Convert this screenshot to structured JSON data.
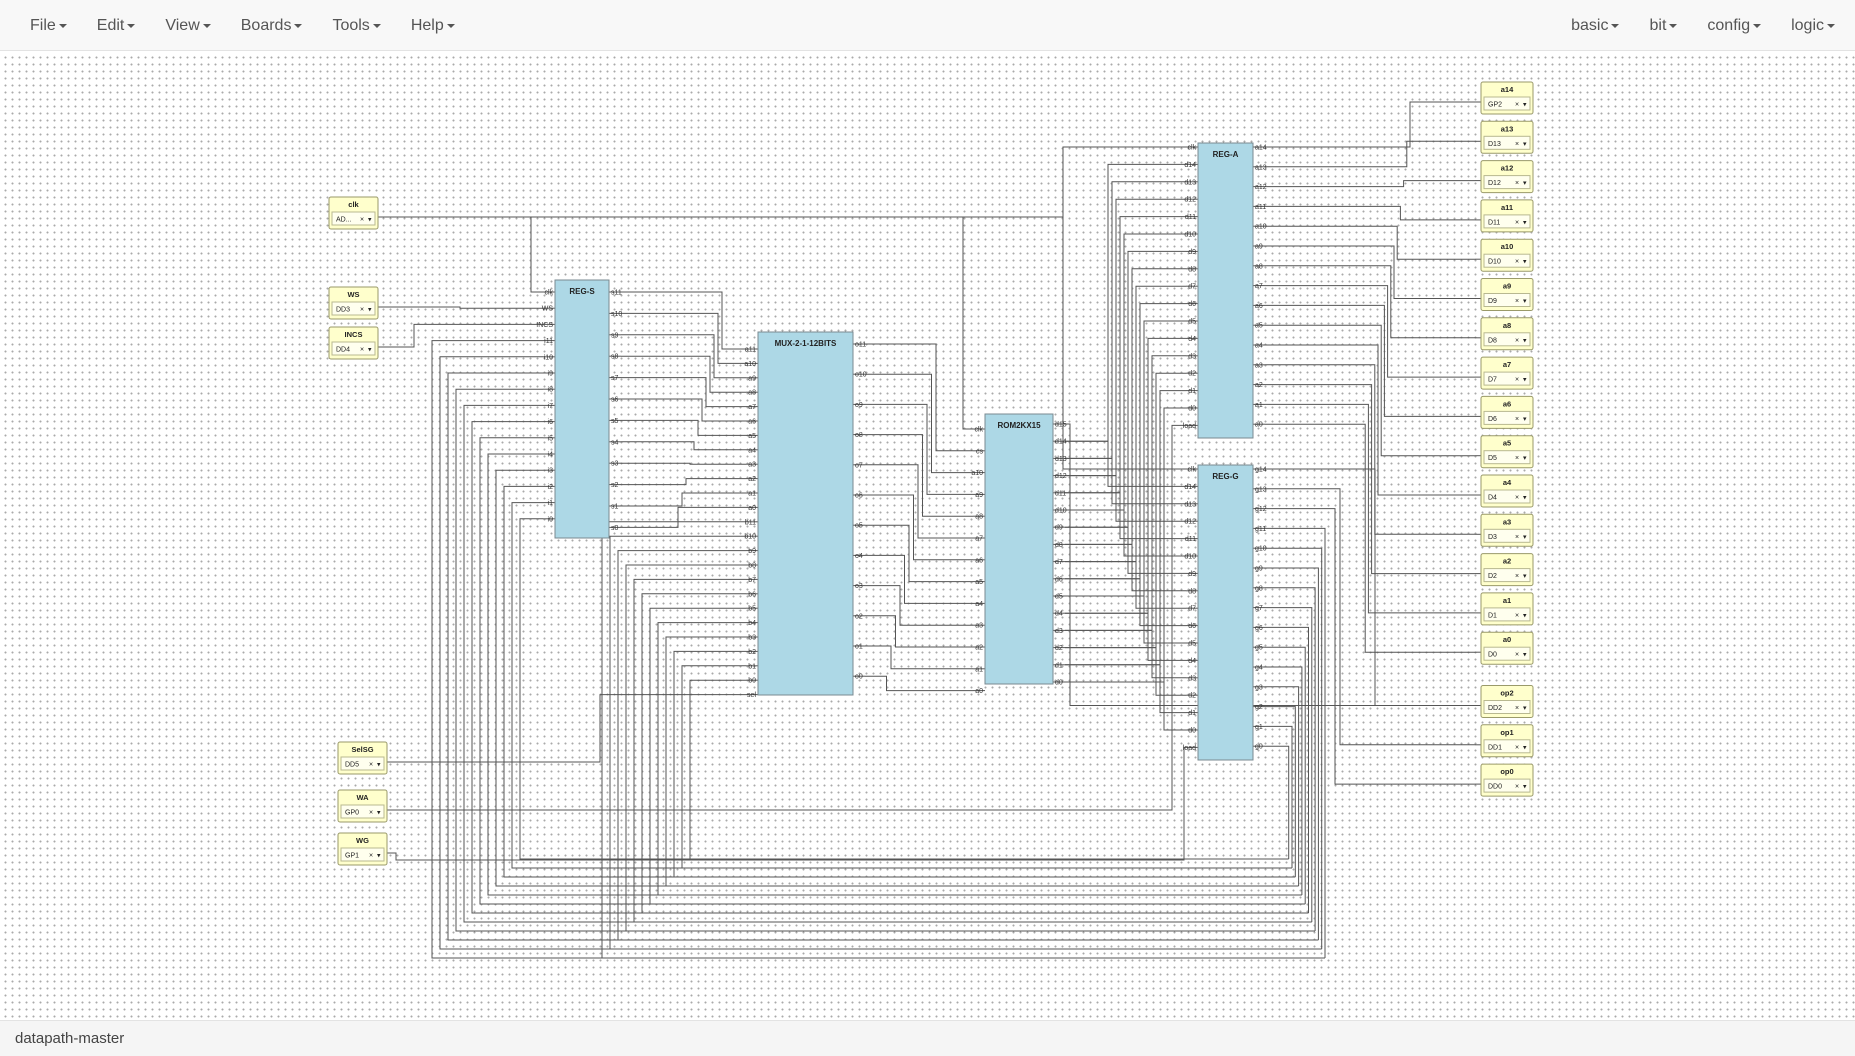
{
  "menu": {
    "left": [
      {
        "label": "File"
      },
      {
        "label": "Edit"
      },
      {
        "label": "View"
      },
      {
        "label": "Boards"
      },
      {
        "label": "Tools"
      },
      {
        "label": "Help"
      }
    ],
    "right": [
      {
        "label": "basic"
      },
      {
        "label": "bit"
      },
      {
        "label": "config"
      },
      {
        "label": "logic"
      }
    ]
  },
  "footer": {
    "project": "datapath-master"
  },
  "blocks": [
    {
      "id": "regs",
      "title": "REG-S",
      "inputs": [
        "clk",
        "WS",
        "INCS",
        "i11",
        "i10",
        "i9",
        "i8",
        "i7",
        "i6",
        "i5",
        "i4",
        "i3",
        "i2",
        "i1",
        "i0"
      ],
      "outputs": [
        "s11",
        "s10",
        "s9",
        "s8",
        "s7",
        "s6",
        "s5",
        "s4",
        "s3",
        "s2",
        "s1",
        "s0"
      ]
    },
    {
      "id": "mux",
      "title": "MUX-2-1-12BITS",
      "inputs": [
        "a11",
        "a10",
        "a9",
        "a8",
        "a7",
        "a6",
        "a5",
        "a4",
        "a3",
        "a2",
        "a1",
        "a0",
        "b11",
        "b10",
        "b9",
        "b8",
        "b7",
        "b6",
        "b5",
        "b4",
        "b3",
        "b2",
        "b1",
        "b0",
        "sel"
      ],
      "outputs": [
        "o11",
        "o10",
        "o9",
        "o8",
        "o7",
        "o6",
        "o5",
        "o4",
        "o3",
        "o2",
        "o1",
        "o0"
      ]
    },
    {
      "id": "rom",
      "title": "ROM2KX15",
      "inputs": [
        "clk",
        "cs",
        "a10",
        "a9",
        "a8",
        "a7",
        "a6",
        "a5",
        "a4",
        "a3",
        "a2",
        "a1",
        "a0"
      ],
      "outputs": [
        "d15",
        "d14",
        "d13",
        "d12",
        "d11",
        "d10",
        "d9",
        "d8",
        "d7",
        "d6",
        "d5",
        "d4",
        "d3",
        "d2",
        "d1",
        "d0"
      ]
    },
    {
      "id": "rega",
      "title": "REG-A",
      "inputs": [
        "clk",
        "d14",
        "d13",
        "d12",
        "d11",
        "d10",
        "d9",
        "d8",
        "d7",
        "d6",
        "d5",
        "d4",
        "d3",
        "d2",
        "d1",
        "d0",
        "load"
      ],
      "outputs": [
        "a14",
        "a13",
        "a12",
        "a11",
        "a10",
        "a9",
        "a8",
        "a7",
        "a6",
        "a5",
        "a4",
        "a3",
        "a2",
        "a1",
        "a0"
      ]
    },
    {
      "id": "regg",
      "title": "REG-G",
      "inputs": [
        "clk",
        "d14",
        "d13",
        "d12",
        "d11",
        "d10",
        "d9",
        "d8",
        "d7",
        "d6",
        "d5",
        "d4",
        "d3",
        "d2",
        "d1",
        "d0",
        "load"
      ],
      "outputs": [
        "g14",
        "g13",
        "g12",
        "g11",
        "g10",
        "g9",
        "g8",
        "g7",
        "g6",
        "g5",
        "g4",
        "g3",
        "g2",
        "g1",
        "g0"
      ]
    }
  ],
  "inputs": [
    {
      "label": "clk",
      "pin": "AD..."
    },
    {
      "label": "WS",
      "pin": "DD3"
    },
    {
      "label": "INCS",
      "pin": "DD4"
    },
    {
      "label": "SelSG",
      "pin": "DD5"
    },
    {
      "label": "WA",
      "pin": "GP0"
    },
    {
      "label": "WG",
      "pin": "GP1"
    }
  ],
  "outputs": [
    {
      "label": "a14",
      "pin": "GP2"
    },
    {
      "label": "a13",
      "pin": "D13"
    },
    {
      "label": "a12",
      "pin": "D12"
    },
    {
      "label": "a11",
      "pin": "D11"
    },
    {
      "label": "a10",
      "pin": "D10"
    },
    {
      "label": "a9",
      "pin": "D9"
    },
    {
      "label": "a8",
      "pin": "D8"
    },
    {
      "label": "a7",
      "pin": "D7"
    },
    {
      "label": "a6",
      "pin": "D6"
    },
    {
      "label": "a5",
      "pin": "D5"
    },
    {
      "label": "a4",
      "pin": "D4"
    },
    {
      "label": "a3",
      "pin": "D3"
    },
    {
      "label": "a2",
      "pin": "D2"
    },
    {
      "label": "a1",
      "pin": "D1"
    },
    {
      "label": "a0",
      "pin": "D0"
    },
    {
      "label": "op2",
      "pin": "DD2"
    },
    {
      "label": "op1",
      "pin": "DD1"
    },
    {
      "label": "op0",
      "pin": "DD0"
    }
  ],
  "io_glyphs": {
    "remove": "×",
    "dropdown": "▾"
  }
}
